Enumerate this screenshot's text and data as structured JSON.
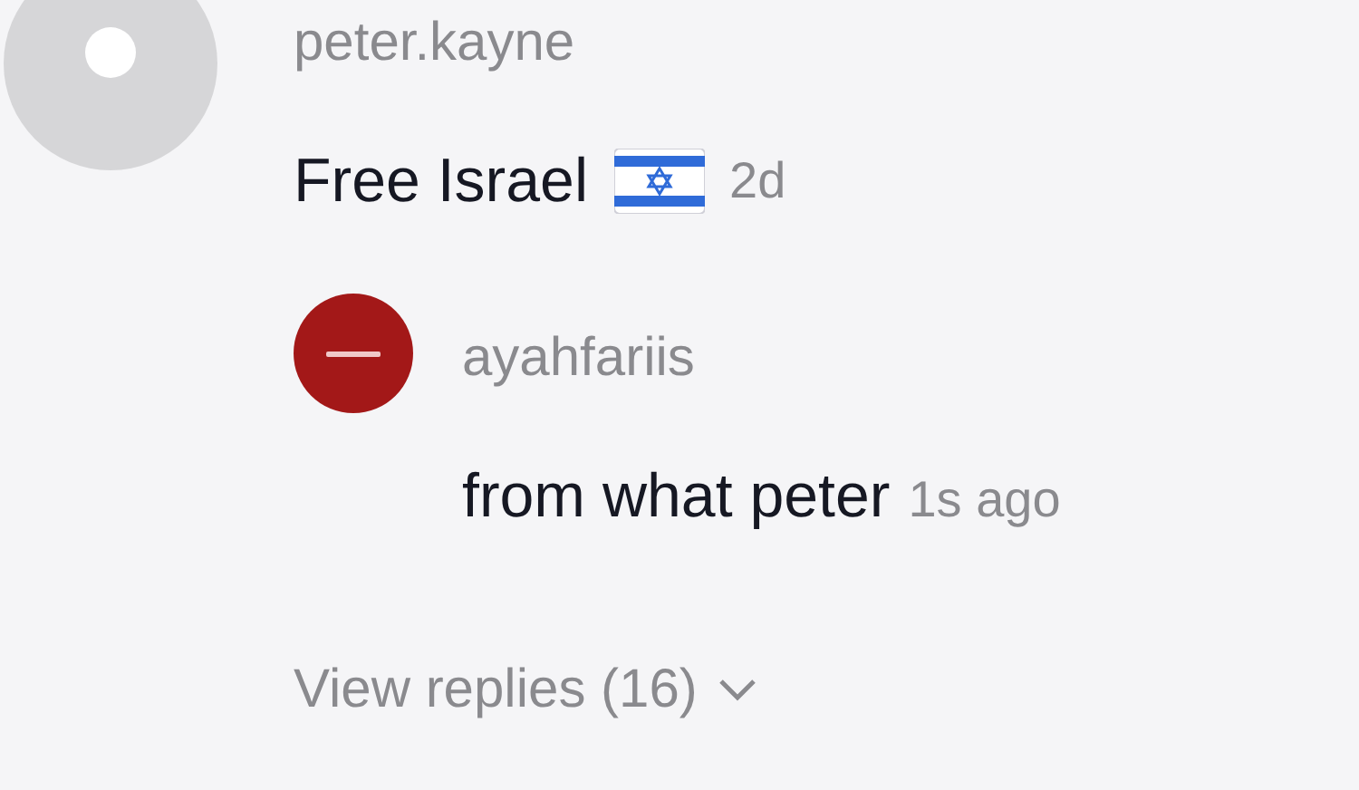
{
  "comment": {
    "username": "peter.kayne",
    "text": "Free Israel",
    "time": "2d"
  },
  "reply": {
    "username": "ayahfariis",
    "text": "from what peter",
    "time": "1s ago"
  },
  "view_replies": "View replies (16)"
}
